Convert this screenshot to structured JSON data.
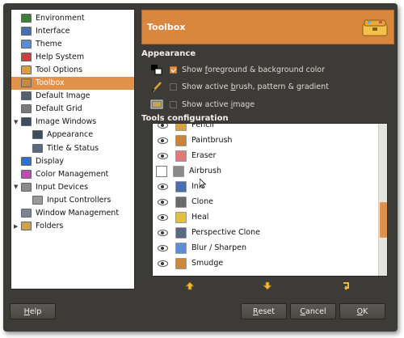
{
  "sidebar": {
    "items": [
      {
        "label": "Environment",
        "icon": "environment-icon",
        "color": "#3d7e3b",
        "indent": 0
      },
      {
        "label": "Interface",
        "icon": "interface-icon",
        "color": "#4a6fb0",
        "indent": 0
      },
      {
        "label": "Theme",
        "icon": "theme-icon",
        "color": "#5b8cd6",
        "indent": 0
      },
      {
        "label": "Help System",
        "icon": "help-system-icon",
        "color": "#c94040",
        "indent": 0
      },
      {
        "label": "Tool Options",
        "icon": "tool-options-icon",
        "color": "#d9a03c",
        "indent": 0
      },
      {
        "label": "Toolbox",
        "icon": "toolbox-icon",
        "color": "#c98a3a",
        "indent": 0
      },
      {
        "label": "Default Image",
        "icon": "default-image-icon",
        "color": "#55606e",
        "indent": 0
      },
      {
        "label": "Default Grid",
        "icon": "default-grid-icon",
        "color": "#7a7a7a",
        "indent": 0
      },
      {
        "label": "Image Windows",
        "icon": "image-windows-icon",
        "color": "#3f4d63",
        "indent": 0
      },
      {
        "label": "Appearance",
        "icon": "appearance-icon",
        "color": "#3f4d63",
        "indent": 1
      },
      {
        "label": "Title & Status",
        "icon": "title-status-icon",
        "color": "#5a6a80",
        "indent": 1
      },
      {
        "label": "Display",
        "icon": "display-icon",
        "color": "#2f6fd8",
        "indent": 0
      },
      {
        "label": "Color Management",
        "icon": "color-management-icon",
        "color": "#c04ab0",
        "indent": 0
      },
      {
        "label": "Input Devices",
        "icon": "input-devices-icon",
        "color": "#8a8a8a",
        "indent": 0
      },
      {
        "label": "Input Controllers",
        "icon": "input-controllers-icon",
        "color": "#9a9a9a",
        "indent": 1
      },
      {
        "label": "Window Management",
        "icon": "window-management-icon",
        "color": "#7d8590",
        "indent": 0
      },
      {
        "label": "Folders",
        "icon": "folders-icon",
        "color": "#c9a544",
        "indent": 0
      }
    ],
    "selected": "Toolbox"
  },
  "header": {
    "title": "Toolbox",
    "icon": "toolbox-chest-icon"
  },
  "appearance": {
    "title": "Appearance",
    "options": [
      {
        "pre": "Show ",
        "key": "f",
        "post": "oreground & background color",
        "checked": true,
        "icon": "fg-bg-color-icon"
      },
      {
        "pre": "Show active ",
        "key": "b",
        "post": "rush, pattern & gradient",
        "checked": false,
        "icon": "brush-icon"
      },
      {
        "pre": "Show active ",
        "key": "i",
        "post": "mage",
        "checked": false,
        "icon": "active-image-icon"
      }
    ]
  },
  "tools": {
    "title": "Tools configuration",
    "items": [
      {
        "label": "Pencil",
        "visible": true,
        "icon": "pencil-icon",
        "color": "#d9a03c"
      },
      {
        "label": "Paintbrush",
        "visible": true,
        "icon": "paintbrush-icon",
        "color": "#c9843a"
      },
      {
        "label": "Eraser",
        "visible": true,
        "icon": "eraser-icon",
        "color": "#e07a7a"
      },
      {
        "label": "Airbrush",
        "visible": false,
        "icon": "airbrush-icon",
        "color": "#8a8a8a"
      },
      {
        "label": "Ink",
        "visible": true,
        "icon": "ink-icon",
        "color": "#4a6fb0"
      },
      {
        "label": "Clone",
        "visible": true,
        "icon": "clone-icon",
        "color": "#6a6a6a"
      },
      {
        "label": "Heal",
        "visible": true,
        "icon": "heal-icon",
        "color": "#e0c040"
      },
      {
        "label": "Perspective Clone",
        "visible": true,
        "icon": "perspective-clone-icon",
        "color": "#5a6a80"
      },
      {
        "label": "Blur / Sharpen",
        "visible": true,
        "icon": "blur-sharpen-icon",
        "color": "#5b8cd6"
      },
      {
        "label": "Smudge",
        "visible": true,
        "icon": "smudge-icon",
        "color": "#c98a3a"
      }
    ]
  },
  "buttons": {
    "help": {
      "key": "H",
      "rest": "elp"
    },
    "reset": {
      "key": "R",
      "rest": "eset"
    },
    "cancel": {
      "key": "C",
      "rest": "ancel"
    },
    "ok": {
      "key": "O",
      "rest": "K"
    }
  },
  "colors": {
    "accent": "#e1914a",
    "window_bg": "#3c3b37",
    "header_bg": "#d9863f"
  }
}
